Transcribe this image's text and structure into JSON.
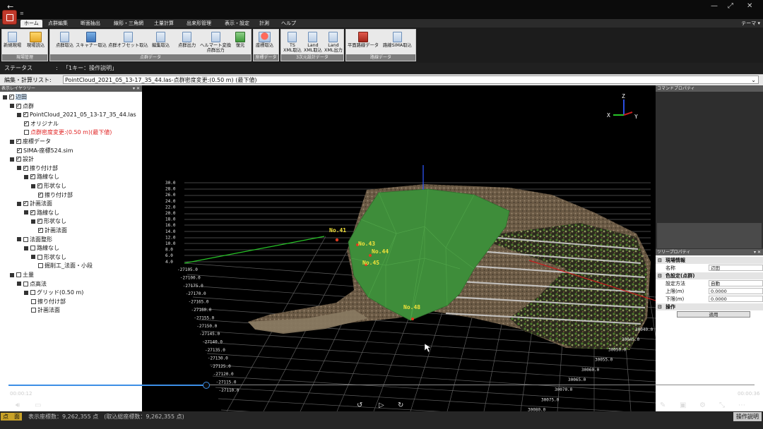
{
  "titlebar": {
    "back": "←",
    "minimize": "—",
    "maximize": "⤢",
    "close": "✕"
  },
  "qat": "≡",
  "tabs": [
    "ホーム",
    "点群編集",
    "断面抽出",
    "線形・三角網",
    "土量計算",
    "出来形管理",
    "表示・設定",
    "計測",
    "ヘルプ"
  ],
  "theme": "テーマ ▾",
  "ribbon": {
    "groups": [
      {
        "title": "現場管理",
        "buttons": [
          "新規現場",
          "現場読込"
        ]
      },
      {
        "title": "点群データ",
        "buttons": [
          "点群取込",
          "スキャナー取込",
          "点群オフセット取込",
          "編集取込",
          "点群出力",
          "ヘルマート変換\n点群出力",
          "復元"
        ]
      },
      {
        "title": "座標データ",
        "buttons": [
          "座標取込"
        ]
      },
      {
        "title": "3次元設計データ",
        "buttons": [
          "TS\nXML取込",
          "Land\nXML取込",
          "Land\nXML出力"
        ]
      },
      {
        "title": "路線データ",
        "buttons": [
          "平面路線データ",
          "路線SIMA取込"
        ]
      }
    ]
  },
  "status": {
    "label": "ステータス",
    "sep": ":",
    "value": "「1キー：操作説明」"
  },
  "edit_list": {
    "label": "編集・計算リスト:",
    "value": "PointCloud_2021_05_13-17_35_44.las-点群密度変更:(0.50 m) (最下値)"
  },
  "tree": {
    "header": "表示レイヤツリー",
    "nodes": [
      {
        "label": "辺田",
        "level": 0,
        "checked": true,
        "expander": true,
        "selected": true
      },
      {
        "label": "点群",
        "level": 1,
        "checked": true,
        "expander": true
      },
      {
        "label": "PointCloud_2021_05_13-17_35_44.las",
        "level": 2,
        "checked": true,
        "expander": true
      },
      {
        "label": "オリジナル",
        "level": 3,
        "checked": true
      },
      {
        "label": "点群密度変更:(0.50 m)(最下値)",
        "level": 3,
        "checked": false,
        "red": true
      },
      {
        "label": "座標データ",
        "level": 1,
        "checked": true,
        "expander": true
      },
      {
        "label": "SIMA-座標524.sim",
        "level": 2,
        "checked": true
      },
      {
        "label": "設計",
        "level": 1,
        "checked": true,
        "expander": true
      },
      {
        "label": "擦り付け部",
        "level": 2,
        "checked": true,
        "expander": true
      },
      {
        "label": "路線なし",
        "level": 3,
        "checked": true,
        "expander": true
      },
      {
        "label": "形状なし",
        "level": 4,
        "checked": true,
        "expander": true
      },
      {
        "label": "擦り付け部",
        "level": 5,
        "checked": true
      },
      {
        "label": "計画法面",
        "level": 2,
        "checked": true,
        "expander": true
      },
      {
        "label": "路線なし",
        "level": 3,
        "checked": true,
        "expander": true
      },
      {
        "label": "形状なし",
        "level": 4,
        "checked": true,
        "expander": true
      },
      {
        "label": "計画法面",
        "level": 5,
        "checked": true
      },
      {
        "label": "法面整形",
        "level": 2,
        "checked": false,
        "expander": true
      },
      {
        "label": "路線なし",
        "level": 3,
        "checked": false,
        "expander": true
      },
      {
        "label": "形状なし",
        "level": 4,
        "checked": false,
        "expander": true
      },
      {
        "label": "掘削工_法面・小段",
        "level": 5,
        "checked": false
      },
      {
        "label": "土量",
        "level": 1,
        "checked": false,
        "expander": true
      },
      {
        "label": "点高法",
        "level": 2,
        "checked": false,
        "expander": true
      },
      {
        "label": "グリッド(0.50 m)",
        "level": 3,
        "checked": false,
        "expander": true
      },
      {
        "label": "擦り付け部",
        "level": 4,
        "checked": false
      },
      {
        "label": "計画法面",
        "level": 4,
        "checked": false
      }
    ]
  },
  "viewport": {
    "z_labels": [
      "30.0",
      "28.0",
      "26.0",
      "24.0",
      "22.0",
      "20.0",
      "18.0",
      "16.0",
      "14.0",
      "12.0",
      "10.0",
      "8.0",
      "6.0",
      "4.0"
    ],
    "y_labels": [
      "-27105.0",
      "-27100.0",
      "-27175.0",
      "-27170.0",
      "-27165.0",
      "-27160.0",
      "-27155.0",
      "-27150.0",
      "-27145.0",
      "-27140.0",
      "-27135.0",
      "-27130.0",
      "-27125.0",
      "-27120.0",
      "-27115.0",
      "-27110.0"
    ],
    "x_labels": [
      "30040.0",
      "30045.0",
      "30050.0",
      "30055.0",
      "30060.0",
      "30065.0",
      "30070.0",
      "30075.0",
      "30080.0"
    ],
    "points": [
      "No.41",
      "No.43",
      "No.44",
      "No.45",
      "No.48"
    ],
    "axes": {
      "x": "X",
      "y": "Y",
      "z": "Z"
    },
    "colors": {
      "surface": "#3f8f3a",
      "grid": "#6a6a6a",
      "green_axis": "#27c427",
      "red_axis": "#c81e1e",
      "blue_axis": "#2a4ee0"
    }
  },
  "right": {
    "cmd_header": "コマンドプロパティ",
    "tree_header": "ツリープロパティ",
    "props": {
      "cat1": "現場情報",
      "name_k": "名称",
      "name_v": "辺田",
      "cat2": "色設定(点群)",
      "method_k": "設定方法",
      "method_v": "自動",
      "upper_k": "上限(m)",
      "upper_v": "0.0000",
      "lower_k": "下限(m)",
      "lower_v": "0.0000",
      "cat3": "操作",
      "apply": "適用"
    }
  },
  "player": {
    "time_left": "00:00:12",
    "time_right": "00:00:36",
    "progress": 0.25
  },
  "bottom": {
    "badge": "点　面",
    "text": "表示座標数：9,262,355 点　(取込総座標数：9,262,355 点)",
    "op": "操作説明"
  }
}
